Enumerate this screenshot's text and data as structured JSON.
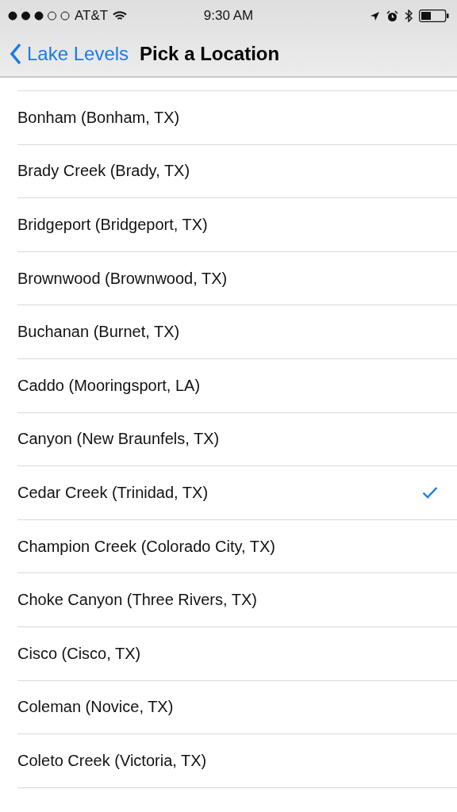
{
  "status_bar": {
    "carrier": "AT&T",
    "time": "9:30 AM"
  },
  "nav_bar": {
    "back_label": "Lake Levels",
    "title": "Pick a Location"
  },
  "rows": [
    {
      "label": "Bonham (Bonham, TX)",
      "selected": false
    },
    {
      "label": "Brady Creek (Brady, TX)",
      "selected": false
    },
    {
      "label": "Bridgeport (Bridgeport, TX)",
      "selected": false
    },
    {
      "label": "Brownwood (Brownwood, TX)",
      "selected": false
    },
    {
      "label": "Buchanan (Burnet, TX)",
      "selected": false
    },
    {
      "label": "Caddo (Mooringsport, LA)",
      "selected": false
    },
    {
      "label": "Canyon (New Braunfels, TX)",
      "selected": false
    },
    {
      "label": "Cedar Creek (Trinidad, TX)",
      "selected": true
    },
    {
      "label": "Champion Creek (Colorado City, TX)",
      "selected": false
    },
    {
      "label": "Choke Canyon (Three Rivers, TX)",
      "selected": false
    },
    {
      "label": "Cisco (Cisco, TX)",
      "selected": false
    },
    {
      "label": "Coleman (Novice, TX)",
      "selected": false
    },
    {
      "label": "Coleto Creek (Victoria, TX)",
      "selected": false
    }
  ]
}
